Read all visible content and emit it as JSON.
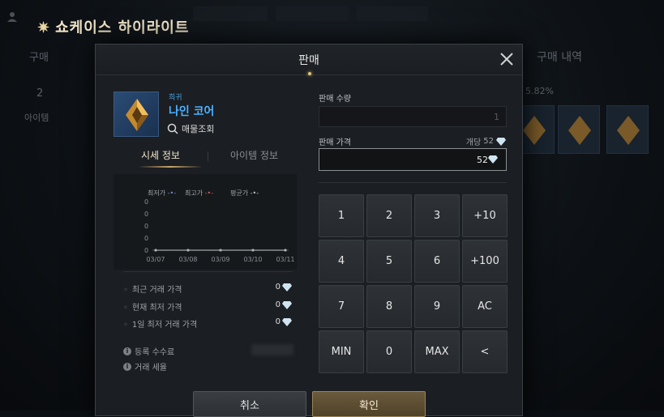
{
  "background": {
    "showcase_title": "쇼케이스 하이라이트",
    "buy_tab": "구매",
    "purchase_history": "구매 내역",
    "stat_percent": "5.82%",
    "side_label": "아이템",
    "left_count": "2"
  },
  "modal": {
    "title": "판매",
    "item": {
      "grade": "희귀",
      "name": "나인 코어",
      "lookup_label": "매물조회"
    },
    "tabs": {
      "market_info": "시세 정보",
      "item_info": "아이템 정보"
    },
    "chart_data": {
      "type": "line",
      "categories": [
        "03/07",
        "03/08",
        "03/09",
        "03/10",
        "03/11"
      ],
      "series": [
        {
          "name": "최저가",
          "values": [
            0,
            0,
            0,
            0,
            0
          ],
          "color": "#7a8fd8"
        },
        {
          "name": "최고가",
          "values": [
            0,
            0,
            0,
            0,
            0
          ],
          "color": "#d85a5a"
        },
        {
          "name": "평균가",
          "values": [
            0,
            0,
            0,
            0,
            0
          ],
          "color": "#c8c8c8"
        }
      ],
      "y_ticks": [
        "0",
        "0",
        "0",
        "0",
        "0"
      ],
      "ylim": [
        0,
        0
      ]
    },
    "stats": [
      {
        "label": "최근 거래 가격",
        "value": "0"
      },
      {
        "label": "현재 최저 가격",
        "value": "0"
      },
      {
        "label": "1일 최저 거래 가격",
        "value": "0"
      }
    ],
    "fees": {
      "registration_fee": "등록 수수료",
      "trade_tax": "거래 세율"
    },
    "sell_quantity_label": "판매 수량",
    "sell_quantity_value": "1",
    "sell_price_label": "판매 가격",
    "unit_price_label": "개당",
    "unit_price_value": "52",
    "price_value": "52",
    "keypad": [
      "1",
      "2",
      "3",
      "+10",
      "4",
      "5",
      "6",
      "+100",
      "7",
      "8",
      "9",
      "AC",
      "MIN",
      "0",
      "MAX",
      "<"
    ],
    "cancel_label": "취소",
    "confirm_label": "확인"
  },
  "colors": {
    "accent_gold": "#caa56a",
    "item_name_blue": "#4cb0ff"
  }
}
